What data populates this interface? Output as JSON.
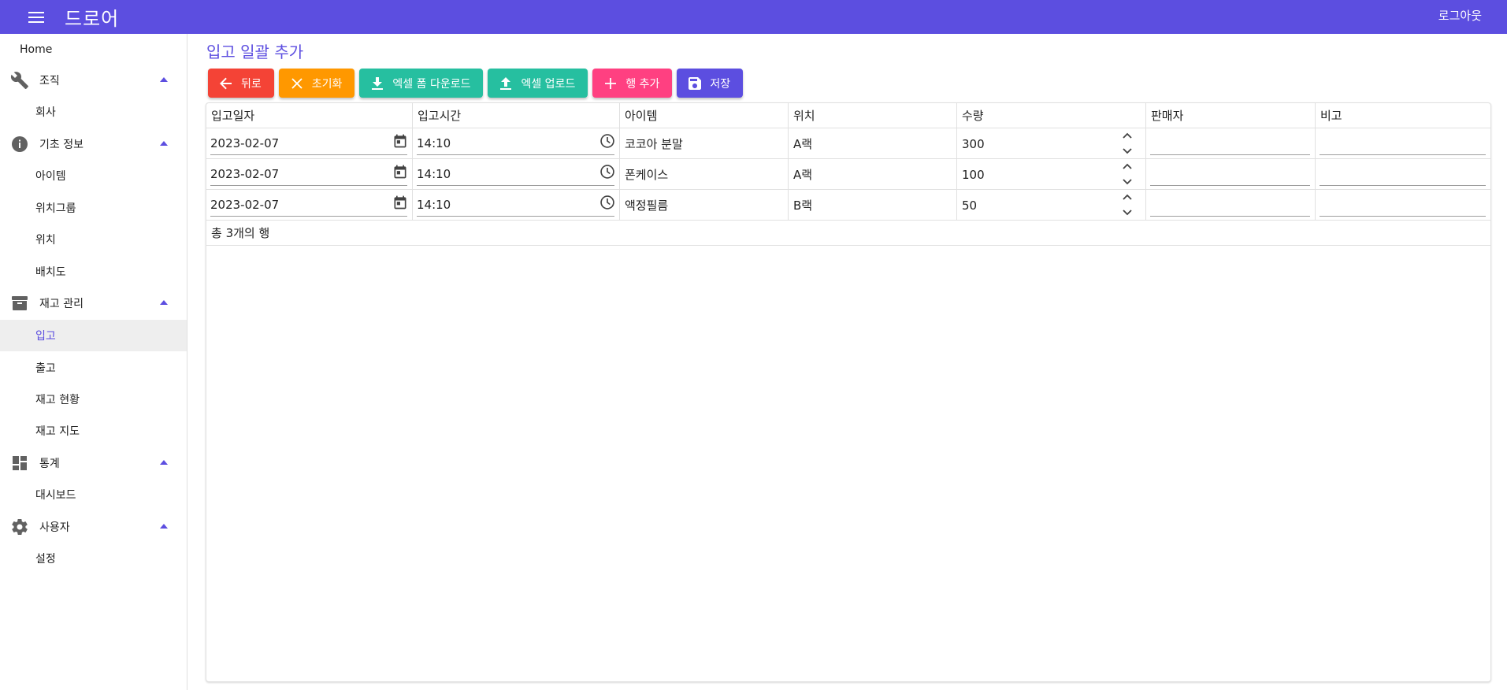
{
  "app": {
    "title": "드로어",
    "logout_label": "로그아웃"
  },
  "sidebar": {
    "home": "Home",
    "groups": [
      {
        "label": "조직",
        "icon": "wrench-icon",
        "items": [
          "회사"
        ]
      },
      {
        "label": "기초 정보",
        "icon": "info-icon",
        "items": [
          "아이템",
          "위치그룹",
          "위치",
          "배치도"
        ]
      },
      {
        "label": "재고 관리",
        "icon": "archive-icon",
        "items": [
          "입고",
          "출고",
          "재고 현황",
          "재고 지도"
        ]
      },
      {
        "label": "통계",
        "icon": "dashboard-icon",
        "items": [
          "대시보드"
        ]
      },
      {
        "label": "사용자",
        "icon": "gear-icon",
        "items": [
          "설정"
        ]
      }
    ],
    "active_item": "입고"
  },
  "page": {
    "title": "입고 일괄 추가"
  },
  "toolbar": {
    "back": "뒤로",
    "reset": "초기화",
    "excel_download": "엑셀 폼 다운로드",
    "excel_upload": "엑셀 업로드",
    "add_row": "행 추가",
    "save": "저장"
  },
  "grid": {
    "columns": [
      "입고일자",
      "입고시간",
      "아이템",
      "위치",
      "수량",
      "판매자",
      "비고"
    ],
    "rows": [
      {
        "date": "2023-02-07",
        "time": "14:10",
        "item": "코코아 분말",
        "location": "A랙",
        "qty": "300",
        "seller": "",
        "note": ""
      },
      {
        "date": "2023-02-07",
        "time": "14:10",
        "item": "폰케이스",
        "location": "A랙",
        "qty": "100",
        "seller": "",
        "note": ""
      },
      {
        "date": "2023-02-07",
        "time": "14:10",
        "item": "액정필름",
        "location": "B랙",
        "qty": "50",
        "seller": "",
        "note": ""
      }
    ],
    "footer": "총 3개의 행"
  },
  "colors": {
    "primary": "#5c4ee0",
    "back": "#f44336",
    "reset": "#ff9800",
    "excel": "#26bfa0",
    "add": "#ff4081"
  }
}
